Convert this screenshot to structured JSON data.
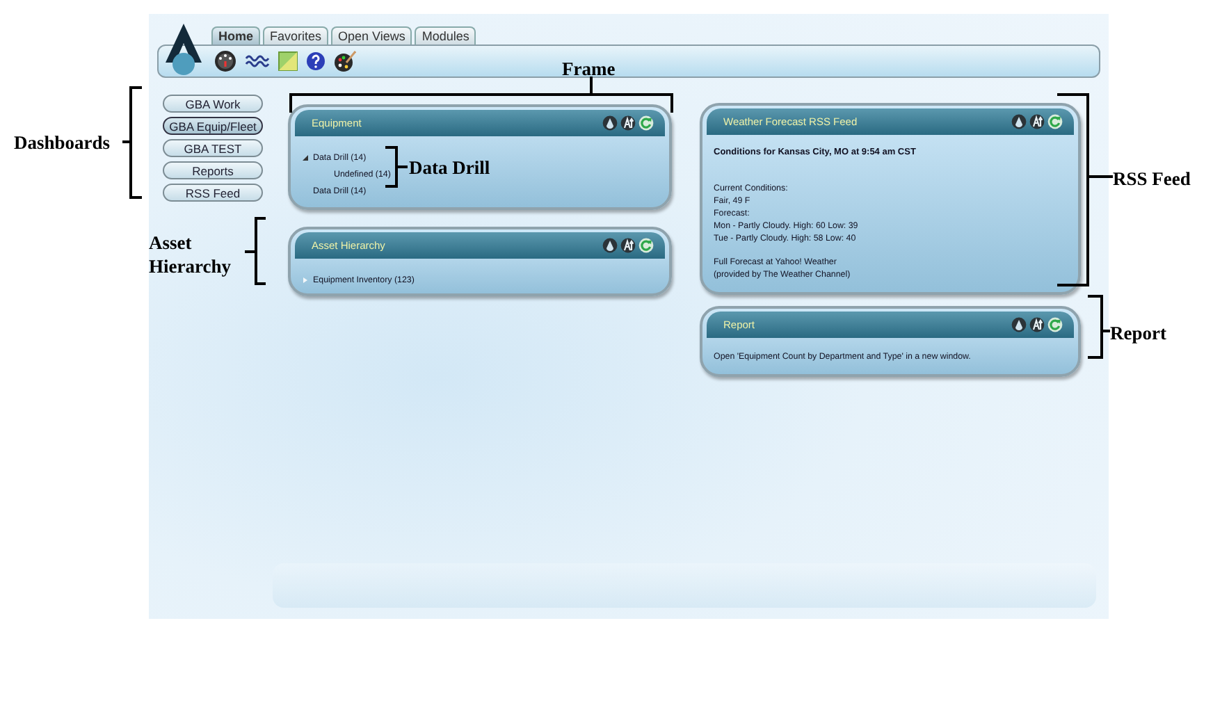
{
  "tabs": [
    {
      "label": "Home",
      "selected": true
    },
    {
      "label": "Favorites",
      "selected": false
    },
    {
      "label": "Open Views",
      "selected": false
    },
    {
      "label": "Modules",
      "selected": false
    }
  ],
  "dashboards": [
    {
      "label": "GBA Work",
      "selected": false
    },
    {
      "label": "GBA Equip/Fleet",
      "selected": true
    },
    {
      "label": "GBA TEST",
      "selected": false
    },
    {
      "label": "Reports",
      "selected": false
    },
    {
      "label": "RSS Feed",
      "selected": false
    }
  ],
  "left_panels": [
    {
      "kind": "tree",
      "title": "Equipment",
      "items": [
        {
          "label": "Data Drill (14)",
          "expanded": true,
          "children": [
            {
              "label": "Undefined (14)"
            }
          ]
        },
        {
          "label": "Data Drill (14)"
        }
      ]
    },
    {
      "kind": "tree",
      "title": "Asset Hierarchy",
      "items": [
        {
          "label": "Equipment Inventory (123)",
          "expanded": false
        }
      ]
    }
  ],
  "right_panels": [
    {
      "kind": "text",
      "title": "Weather Forecast RSS Feed",
      "heading": "Conditions for Kansas City, MO at 9:54 am CST",
      "blocks": [
        [
          "Current Conditions:",
          "Fair, 49 F",
          "Forecast:",
          "Mon - Partly Cloudy. High: 60 Low: 39",
          "Tue - Partly Cloudy. High: 58 Low: 40"
        ],
        [
          "Full Forecast at Yahoo! Weather",
          "(provided by The Weather Channel)"
        ]
      ]
    },
    {
      "kind": "text",
      "title": "Report",
      "blocks": [
        [
          "Open 'Equipment Count by Department and Type' in a new window."
        ]
      ]
    }
  ],
  "annotations": [
    {
      "text": "Dashboards"
    },
    {
      "text": "Frame"
    },
    {
      "text": "Data Drill"
    },
    {
      "text": "Asset Hierarchy"
    },
    {
      "text": "RSS Feed"
    },
    {
      "text": "Report"
    }
  ]
}
